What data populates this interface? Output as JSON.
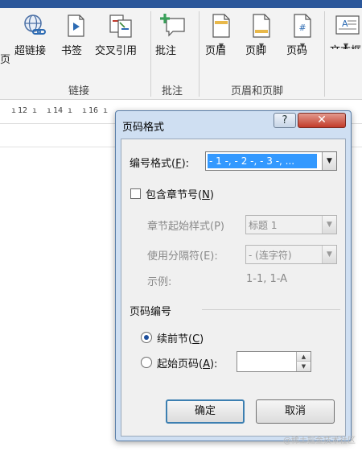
{
  "ribbon": {
    "partial_left_label": "页",
    "buttons": {
      "hyperlink": "超链接",
      "bookmark": "书签",
      "cross_reference": "交叉引用",
      "comment": "批注",
      "header": "页眉",
      "footer": "页脚",
      "page_number": "页码",
      "textbox": "文本框"
    },
    "groups": {
      "links": "链接",
      "comments": "批注",
      "header_footer": "页眉和页脚"
    },
    "accent_color": "#2b579a"
  },
  "ruler": {
    "ticks": [
      "12",
      "14",
      "16"
    ]
  },
  "dialog": {
    "title": "页码格式",
    "help_glyph": "?",
    "close_glyph": "✕",
    "number_format": {
      "label": "编号格式(",
      "key": "F",
      "label_tail": "):",
      "value": "- 1 -, - 2 -, - 3 -, ..."
    },
    "include_chapter": {
      "label": "包含章节号(",
      "key": "N",
      "label_tail": ")",
      "checked": false
    },
    "chapter_style": {
      "label": "章节起始样式(P)",
      "value": "标题 1"
    },
    "separator": {
      "label": "使用分隔符(E):",
      "value": "-    (连字符)"
    },
    "example": {
      "label": "示例:",
      "value": "1-1, 1-A"
    },
    "page_numbering": {
      "section_label": "页码编号",
      "continue": {
        "label": "续前节(",
        "key": "C",
        "label_tail": ")",
        "selected": true
      },
      "start_at": {
        "label": "起始页码(",
        "key": "A",
        "label_tail": "):",
        "value": ""
      }
    },
    "ok_label": "确定",
    "cancel_label": "取消"
  },
  "watermark": "@稀土掘金技术社区"
}
